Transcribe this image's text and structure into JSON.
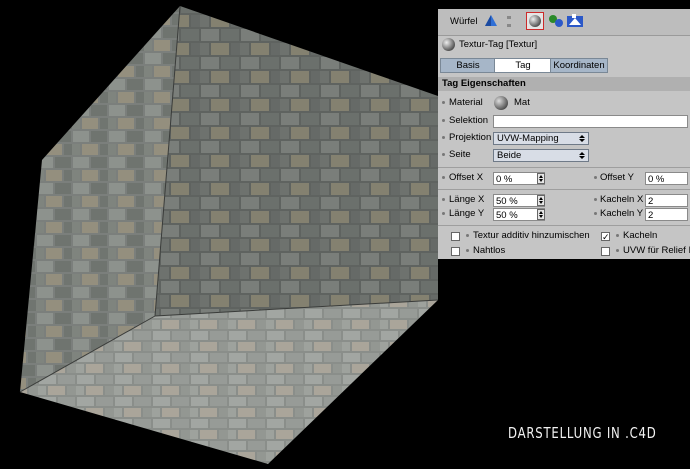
{
  "caption": "DARSTELLUNG IN .C4D",
  "object_bar": {
    "object_name": "Würfel",
    "icons": [
      "cube-object-icon",
      "texture-tag-icon",
      "material-tags-icon",
      "selection-tag-icon"
    ]
  },
  "panel": {
    "title": "Textur-Tag [Textur]",
    "tabs": [
      {
        "label": "Basis",
        "active": false
      },
      {
        "label": "Tag",
        "active": true
      },
      {
        "label": "Koordinaten",
        "active": false
      }
    ],
    "section_title": "Tag Eigenschaften",
    "material": {
      "label": "Material",
      "value": "Mat"
    },
    "selektion": {
      "label": "Selektion",
      "value": ""
    },
    "projektion": {
      "label": "Projektion",
      "value": "UVW-Mapping"
    },
    "seite": {
      "label": "Seite",
      "value": "Beide"
    },
    "offset_x": {
      "label": "Offset X",
      "value": "0 %"
    },
    "offset_y": {
      "label": "Offset Y",
      "value": "0 %"
    },
    "laenge_x": {
      "label": "Länge X",
      "value": "50 %"
    },
    "laenge_y": {
      "label": "Länge Y",
      "value": "50 %"
    },
    "kacheln_x": {
      "label": "Kacheln X",
      "value": "2"
    },
    "kacheln_y": {
      "label": "Kacheln Y",
      "value": "2"
    },
    "checkboxes": {
      "textur_additiv": {
        "label": "Textur additiv hinzumischen",
        "checked": false
      },
      "kacheln": {
        "label": "Kacheln",
        "checked": true
      },
      "nahtlos": {
        "label": "Nahtlos",
        "checked": false
      },
      "uvw_relief": {
        "label": "UVW für Relief I",
        "checked": false
      }
    }
  }
}
